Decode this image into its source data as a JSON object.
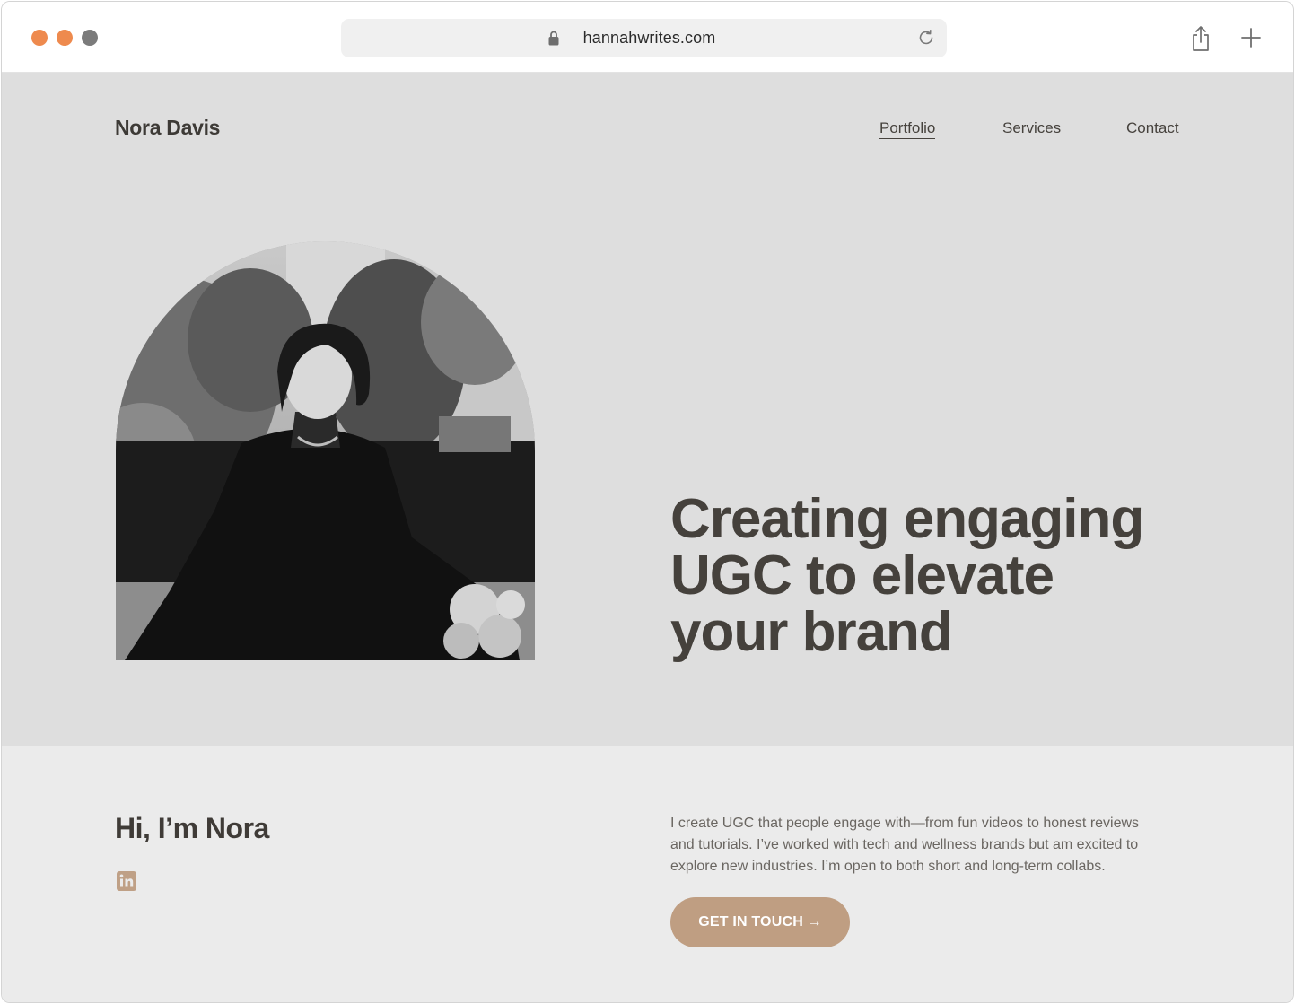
{
  "browser": {
    "url": "hannahwrites.com",
    "traffic_lights": [
      "#ee8a4e",
      "#ee8a4e",
      "#7b7b7b"
    ],
    "icons": [
      "lock-icon",
      "reload-icon",
      "share-icon",
      "plus-icon"
    ]
  },
  "site": {
    "brand": "Nora Davis",
    "nav": [
      {
        "label": "Portfolio",
        "active": true
      },
      {
        "label": "Services",
        "active": false
      },
      {
        "label": "Contact",
        "active": false
      }
    ]
  },
  "hero": {
    "headline_lines": [
      "Creating engaging",
      "UGC to elevate",
      "your brand"
    ],
    "background": "#dedede"
  },
  "intro": {
    "title": "Hi, I’m Nora",
    "social_icon": "linkedin-icon",
    "body_lines": [
      "I create UGC that people engage with—from fun videos to honest reviews",
      "and tutorials. I’ve worked with tech and wellness brands but am excited to",
      "explore new industries. I’m open to both short and long-term collabs."
    ],
    "cta_label": "GET IN TOUCH →",
    "accent": "#bf9e82",
    "background": "#ebebeb"
  }
}
